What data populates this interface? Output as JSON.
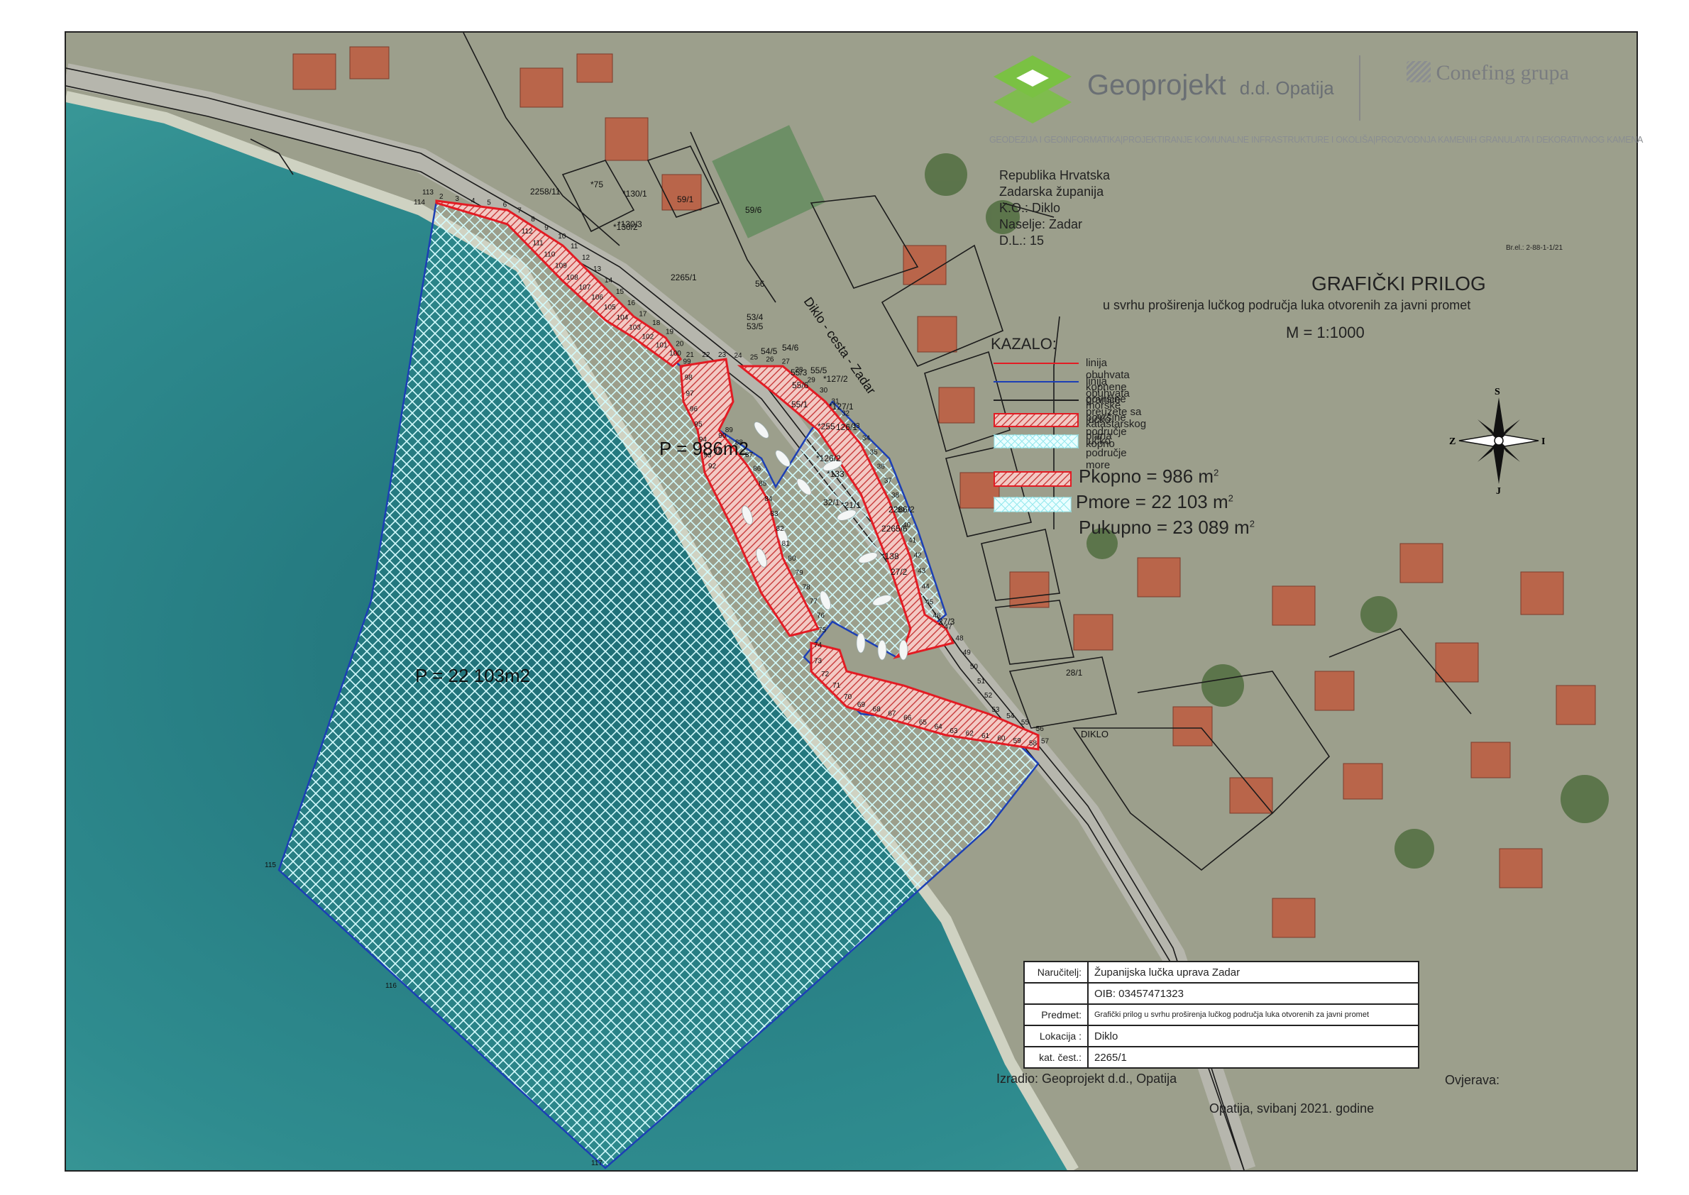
{
  "company": {
    "name": "Geoprojekt",
    "suffix": "d.d. Opatija",
    "partner": "Conefing grupa",
    "tagline": "GEODEZIJA I GEOINFORMATIKA|PROJEKTIRANJE KOMUNALNE INFRASTRUKTURE I OKOLIŠA|PROIZVODNJA KAMENIH GRANULATA I DEKORATIVNOG KAMENA",
    "brand_color": "#7ac143",
    "text_color": "#6a6f74"
  },
  "location_info": [
    "Republika Hrvatska",
    "Zadarska županija",
    "K.O.: Diklo",
    "Naselje: Zadar",
    "D.L.: 15"
  ],
  "ref_number": "Br.el.: 2-88-1-1/21",
  "title": "GRAFIČKI PRILOG",
  "subtitle": "u svrhu proširenja lučkog područja luka otvorenih za javni promet",
  "scale": "M = 1:1000",
  "legend": {
    "title": "KAZALO:",
    "items": [
      {
        "label": "linija obuhvata kopnene površine",
        "symbol": "red-line"
      },
      {
        "label": "linija obuhvata morske površine",
        "symbol": "blue-line"
      },
      {
        "label": "granice preuzete sa katastarskog plana",
        "symbol": "black-line"
      },
      {
        "label": "lučko područje kopno",
        "symbol": "red-hatch"
      },
      {
        "label": "lučko područje more",
        "symbol": "cyan-crosshatch"
      }
    ]
  },
  "areas": {
    "land": "Pkopno = 986 m",
    "sea": "Pmore = 22 103 m",
    "total": "Pukupno = 23 089 m",
    "sup": "2"
  },
  "compass": {
    "north": "S",
    "south": "J",
    "west": "Z",
    "east": "I"
  },
  "info_table": [
    {
      "key": "Naručitelj:",
      "value": "Županijska lučka uprava Zadar"
    },
    {
      "key": "",
      "value": "OIB: 03457471323"
    },
    {
      "key": "Predmet:",
      "value": "Grafički prilog u svrhu proširenja lučkog područja luka otvorenih za javni promet"
    },
    {
      "key": "Lokacija :",
      "value": "Diklo"
    },
    {
      "key": "kat. čest.:",
      "value": "2265/1"
    }
  ],
  "footer": {
    "made_by": "Izradio: Geoprojekt d.d., Opatija",
    "approves": "Ovjerava:",
    "place_date": "Opatija, svibanj 2021. godine"
  },
  "map_labels": {
    "land_area": "P = 986m2",
    "sea_area": "P = 22 103m2",
    "road": "Diklo - cesta - Zadar",
    "place": "DIKLO",
    "parcels": [
      "2258/11",
      "*75",
      "*130/1",
      "*130/3",
      "*130/2",
      "59/1",
      "59/6",
      "56",
      "2265/1",
      "53/4",
      "53/5",
      "54/6",
      "54/5",
      "55/3",
      "55/6",
      "55/1",
      "55/5",
      "*127/2",
      "*127/1",
      "*255",
      "126/1",
      "*126/2",
      "*133",
      "32/1",
      "*21/1",
      "2265/6",
      "*138",
      "27/2",
      "27/3",
      "28/1",
      "2266/2"
    ],
    "points": [
      "113",
      "114",
      "2",
      "3",
      "4",
      "5",
      "6",
      "7",
      "8",
      "9",
      "10",
      "11",
      "12",
      "13",
      "14",
      "15",
      "16",
      "17",
      "18",
      "19",
      "20",
      "21",
      "22",
      "23",
      "24",
      "25",
      "26",
      "27",
      "28",
      "29",
      "30",
      "31",
      "32",
      "33",
      "34",
      "35",
      "36",
      "37",
      "38",
      "39",
      "40",
      "41",
      "42",
      "43",
      "44",
      "45",
      "46",
      "47",
      "48",
      "49",
      "50",
      "51",
      "52",
      "53",
      "54",
      "55",
      "56",
      "57",
      "58",
      "59",
      "60",
      "61",
      "62",
      "63",
      "64",
      "65",
      "66",
      "67",
      "68",
      "69",
      "70",
      "71",
      "72",
      "73",
      "74",
      "75",
      "76",
      "77",
      "78",
      "79",
      "80",
      "81",
      "82",
      "83",
      "84",
      "85",
      "86",
      "87",
      "88",
      "89",
      "90",
      "91",
      "92",
      "93",
      "94",
      "95",
      "96",
      "97",
      "98",
      "99",
      "100",
      "101",
      "102",
      "103",
      "104",
      "105",
      "106",
      "107",
      "108",
      "109",
      "110",
      "111",
      "112",
      "115",
      "116",
      "117"
    ]
  },
  "colors": {
    "sea": "#2f8b8e",
    "land": "#9aa08a",
    "land_boundary": "#e31b23",
    "sea_boundary": "#1c3fb5",
    "hatch_sea": "#c6f6f8",
    "hatch_land": "#d33b3b"
  }
}
